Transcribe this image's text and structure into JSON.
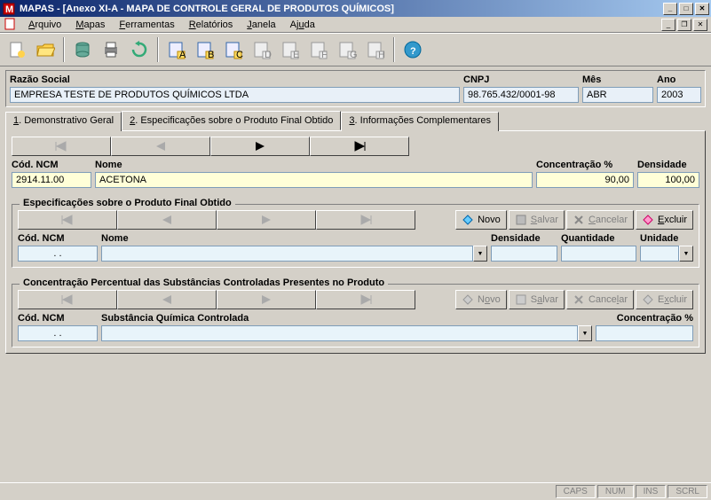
{
  "window": {
    "title": "MAPAS - [Anexo XI-A - MAPA DE CONTROLE GERAL DE PRODUTOS QUÍMICOS]"
  },
  "menu": {
    "arquivo": "Arquivo",
    "mapas": "Mapas",
    "ferramentas": "Ferramentas",
    "relatorios": "Relatórios",
    "janela": "Janela",
    "ajuda": "Ajuda"
  },
  "header": {
    "razao_label": "Razão Social",
    "razao_value": "EMPRESA TESTE DE PRODUTOS QUÍMICOS LTDA",
    "cnpj_label": "CNPJ",
    "cnpj_value": "98.765.432/0001-98",
    "mes_label": "Mês",
    "mes_value": "ABR",
    "ano_label": "Ano",
    "ano_value": "2003"
  },
  "tabs": {
    "t1": "1. Demonstrativo Geral",
    "t2": "2. Especificações sobre o Produto Final Obtido",
    "t3": "3. Informações Complementares"
  },
  "grid1": {
    "h_ncm": "Cód. NCM",
    "h_nome": "Nome",
    "h_conc": "Concentração %",
    "h_dens": "Densidade",
    "v_ncm": "2914.11.00",
    "v_nome": "ACETONA",
    "v_conc": "90,00",
    "v_dens": "100,00"
  },
  "group2": {
    "legend": "Especificações sobre o Produto Final Obtido",
    "h_ncm": "Cód. NCM",
    "h_nome": "Nome",
    "h_dens": "Densidade",
    "h_qtd": "Quantidade",
    "h_unid": "Unidade",
    "mask": " .  .  "
  },
  "group3": {
    "legend": "Concentração Percentual das Substâncias Controladas Presentes no Produto",
    "h_ncm": "Cód. NCM",
    "h_sub": "Substância Química Controlada",
    "h_conc": "Concentração %",
    "mask": " .  .  "
  },
  "buttons": {
    "novo": "Novo",
    "salvar": "Salvar",
    "cancelar": "Cancelar",
    "excluir": "Excluir"
  },
  "status": {
    "caps": "CAPS",
    "num": "NUM",
    "ins": "INS",
    "scrl": "SCRL"
  }
}
